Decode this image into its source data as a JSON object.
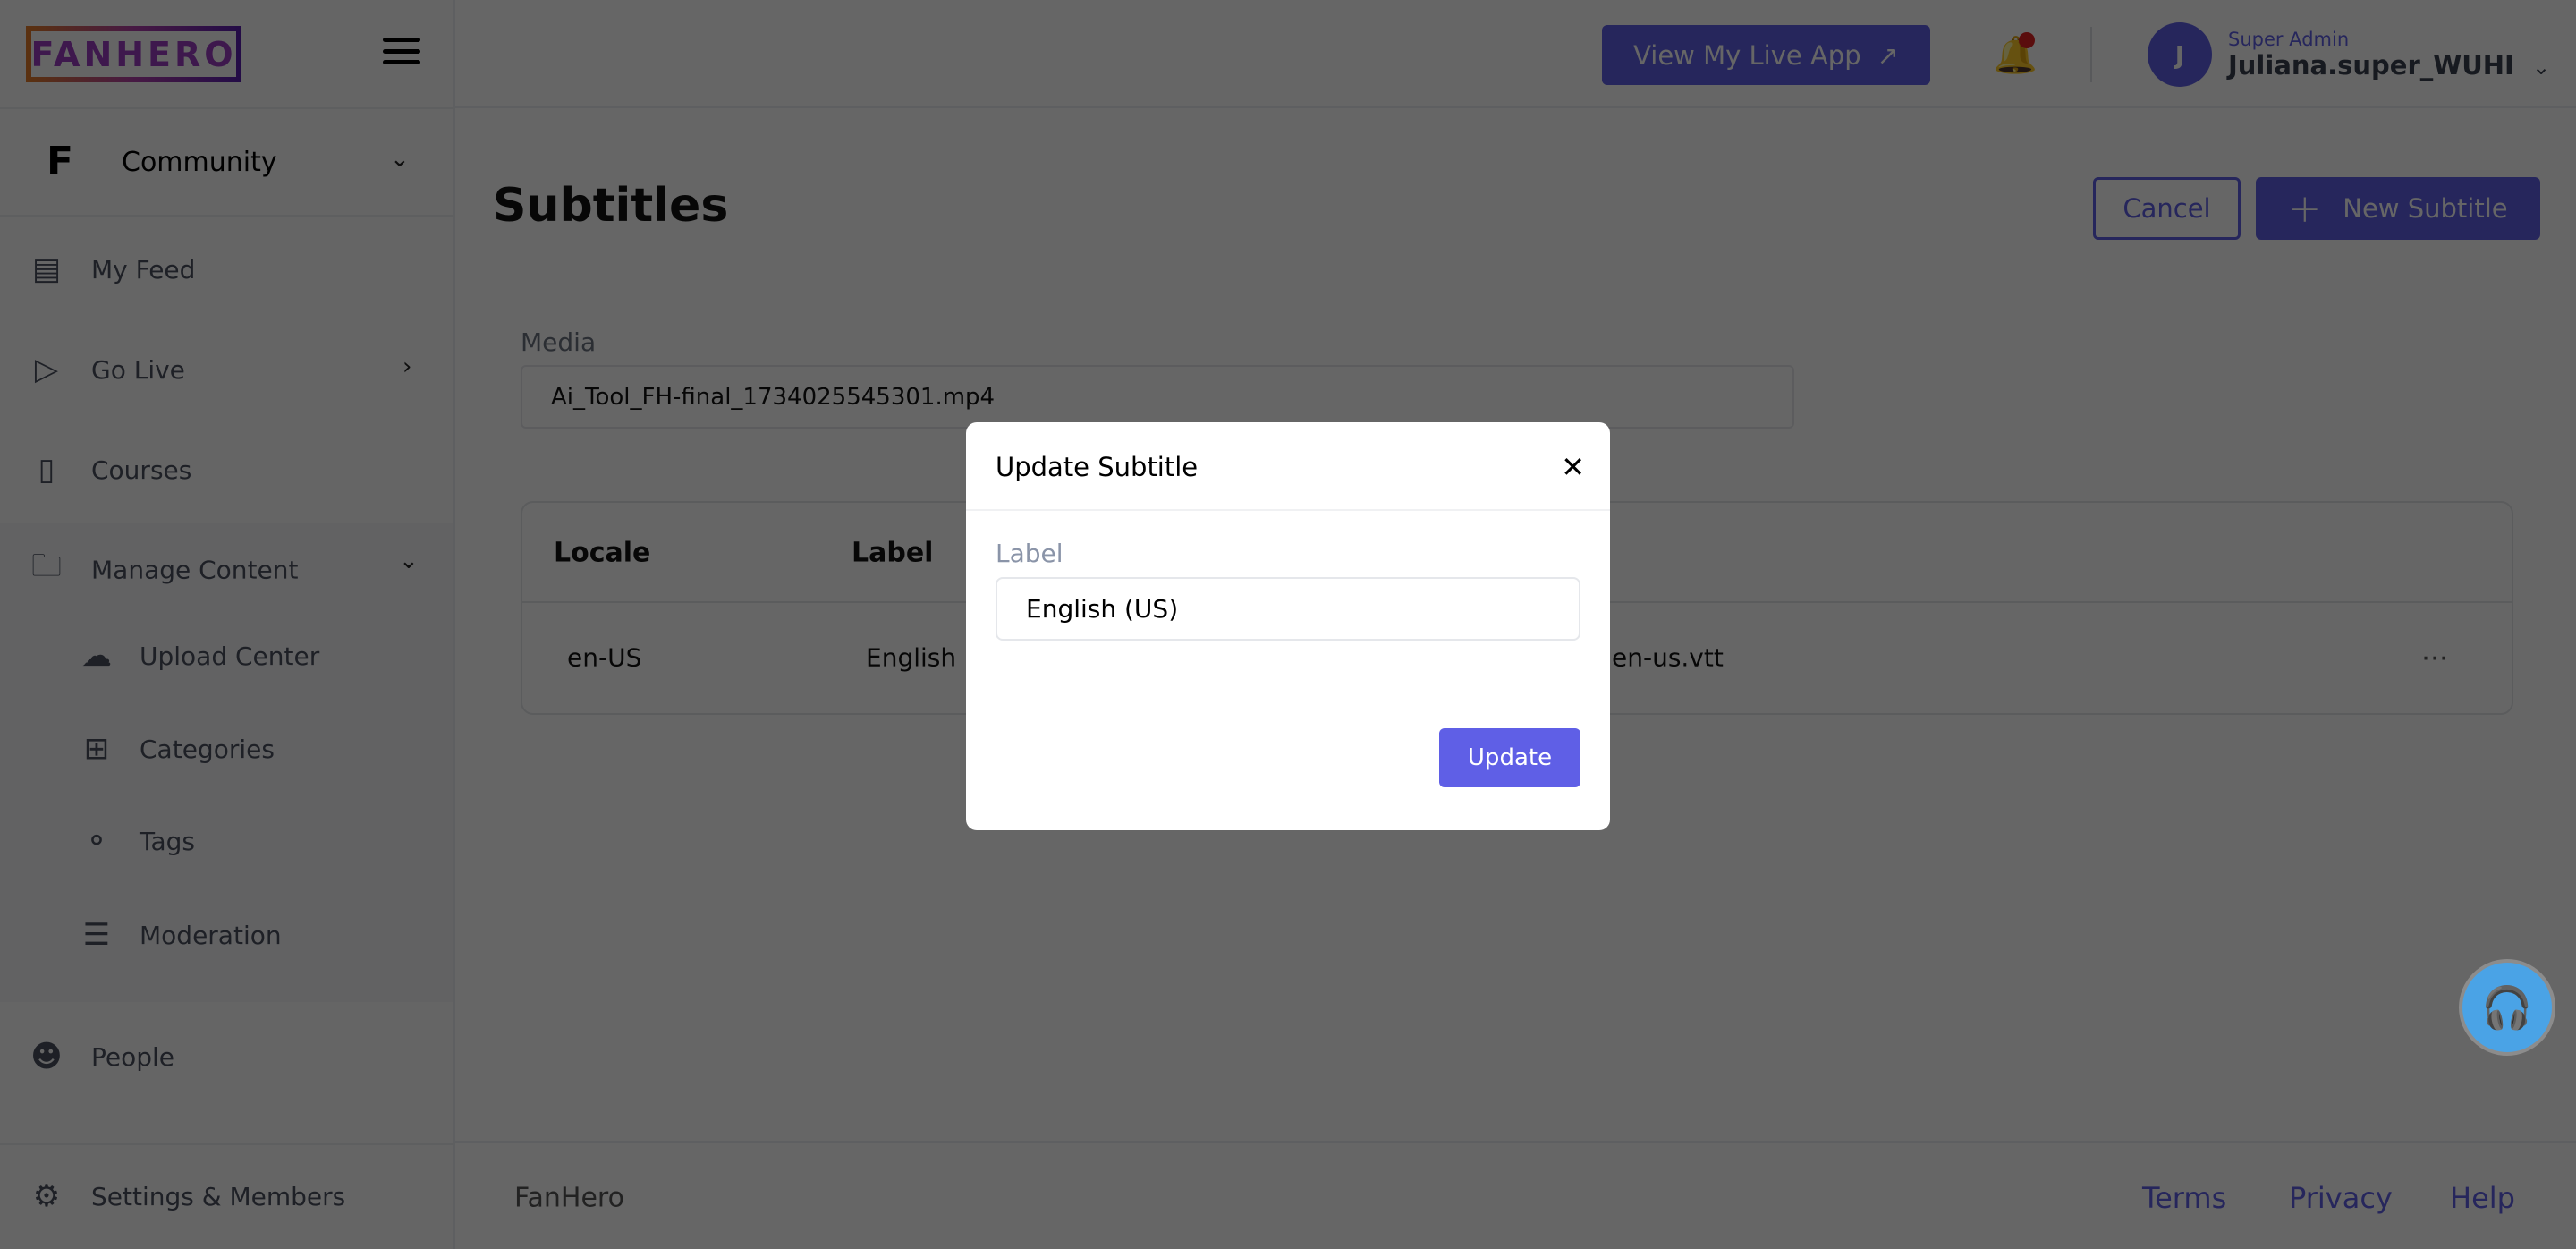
{
  "logo": {
    "text": "FANHERO"
  },
  "sidebar": {
    "community": "Community",
    "items": [
      {
        "label": "My Feed",
        "icon": "feed-icon"
      },
      {
        "label": "Go Live",
        "icon": "live-icon"
      },
      {
        "label": "Courses",
        "icon": "book-icon"
      },
      {
        "label": "Manage Content",
        "icon": "folder-gear-icon"
      },
      {
        "label": "Upload Center",
        "icon": "cloud-upload-icon"
      },
      {
        "label": "Categories",
        "icon": "grid-plus-icon"
      },
      {
        "label": "Tags",
        "icon": "tag-icon"
      },
      {
        "label": "Moderation",
        "icon": "sliders-icon"
      },
      {
        "label": "People",
        "icon": "people-icon"
      },
      {
        "label": "Settings & Members",
        "icon": "gear-icon"
      }
    ]
  },
  "header": {
    "live_app": "View My Live App",
    "avatar_initial": "J",
    "role": "Super Admin",
    "username": "Juliana.super_WUHI"
  },
  "page": {
    "title": "Subtitles",
    "cancel": "Cancel",
    "new_subtitle": "New Subtitle",
    "media_label": "Media",
    "media_value": "Ai_Tool_FH-final_1734025545301.mp4",
    "table": {
      "headers": [
        "Locale",
        "Label"
      ],
      "rows": [
        {
          "locale": "en-US",
          "label": "English",
          "file": "en-us.vtt"
        }
      ]
    }
  },
  "footer": {
    "brand": "FanHero",
    "links": [
      "Terms",
      "Privacy",
      "Help"
    ]
  },
  "modal": {
    "title": "Update Subtitle",
    "label": "Label",
    "value": "English (US)",
    "submit": "Update"
  },
  "colors": {
    "primary": "#5f5fe6",
    "overlay": "rgba(0,0,0,0.6)",
    "help_widget": "#4aa3e6",
    "notification": "#e02020"
  }
}
